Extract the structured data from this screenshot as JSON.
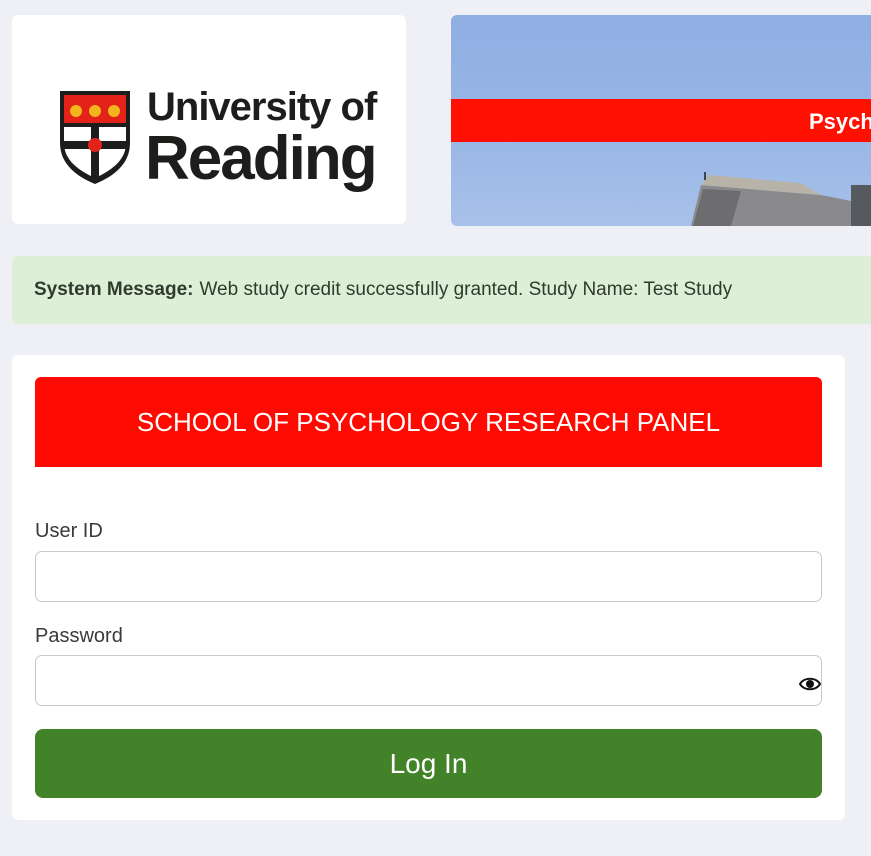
{
  "logo": {
    "line1": "University of",
    "line2": "Reading"
  },
  "banner": {
    "text": "Psych"
  },
  "system_message": {
    "label": "System Message:",
    "text": "Web study credit successfully granted. Study Name: Test Study"
  },
  "login": {
    "panel_title": "SCHOOL OF PSYCHOLOGY RESEARCH PANEL",
    "user_id_label": "User ID",
    "user_id_value": "",
    "password_label": "Password",
    "password_value": "",
    "submit_label": "Log In"
  },
  "colors": {
    "page_bg": "#eff0f5",
    "brand_red": "#ff0a00",
    "login_green": "#428228",
    "message_bg": "#deefd8"
  },
  "icons": {
    "crest": "university-crest-icon",
    "show_password": "eye-icon"
  }
}
